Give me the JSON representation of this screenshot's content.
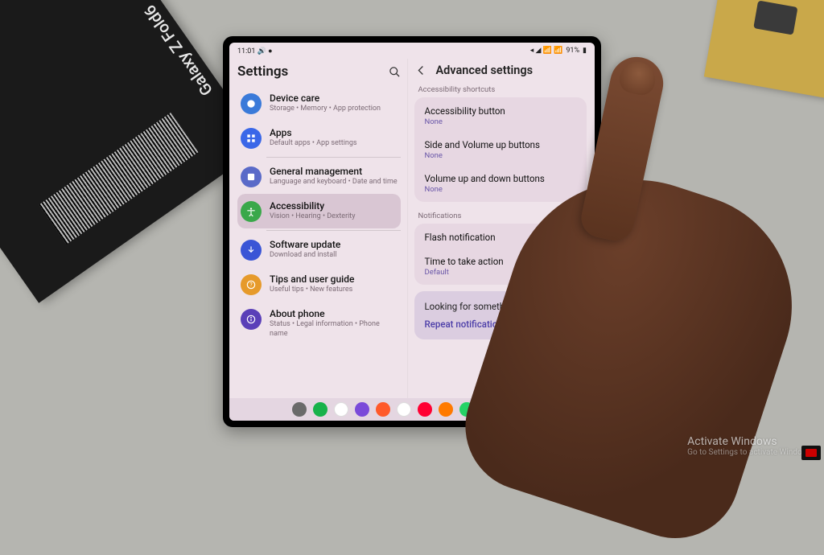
{
  "physical": {
    "box_label": "Galaxy Z Fold6"
  },
  "status": {
    "time": "11:01",
    "left_icons": "🔊 ●",
    "right_icons": "◂ ◢ 📶 📶",
    "battery_text": "91%",
    "battery_icon": "▮"
  },
  "left_pane": {
    "title": "Settings",
    "items": [
      {
        "icon_color": "#3a7ad9",
        "title": "Device care",
        "subtitle": "Storage  •  Memory  •  App protection"
      },
      {
        "icon_color": "#3a67e8",
        "title": "Apps",
        "subtitle": "Default apps  •  App settings"
      },
      {
        "icon_color": "#5a6ac8",
        "title": "General management",
        "subtitle": "Language and keyboard  •  Date and time"
      },
      {
        "icon_color": "#3aa84a",
        "title": "Accessibility",
        "subtitle": "Vision  •  Hearing  •  Dexterity",
        "selected": true
      },
      {
        "icon_color": "#3a55d6",
        "title": "Software update",
        "subtitle": "Download and install"
      },
      {
        "icon_color": "#e69a2b",
        "title": "Tips and user guide",
        "subtitle": "Useful tips  •  New features"
      },
      {
        "icon_color": "#5a3fb8",
        "title": "About phone",
        "subtitle": "Status  •  Legal information  •  Phone name"
      }
    ]
  },
  "right_pane": {
    "title": "Advanced settings",
    "sections": [
      {
        "label": "Accessibility shortcuts",
        "items": [
          {
            "title": "Accessibility button",
            "value": "None"
          },
          {
            "title": "Side and Volume up buttons",
            "value": "None"
          },
          {
            "title": "Volume up and down buttons",
            "value": "None"
          }
        ]
      },
      {
        "label": "Notifications",
        "items": [
          {
            "title": "Flash notification",
            "value": ""
          },
          {
            "title": "Time to take action",
            "value": "Default"
          }
        ]
      }
    ],
    "looking": {
      "question": "Looking for something else?",
      "link": "Repeat notification alerts"
    }
  },
  "taskbar": {
    "colors": [
      "#6a6a6a",
      "#17b24a",
      "#ff3860",
      "#7a4ad9",
      "#ff5a2a",
      "#ffffff",
      "#ff0033",
      "#ff7a00",
      "#25d366"
    ]
  },
  "watermark": {
    "line1": "Activate Windows",
    "line2": "Go to Settings to activate Windows."
  }
}
